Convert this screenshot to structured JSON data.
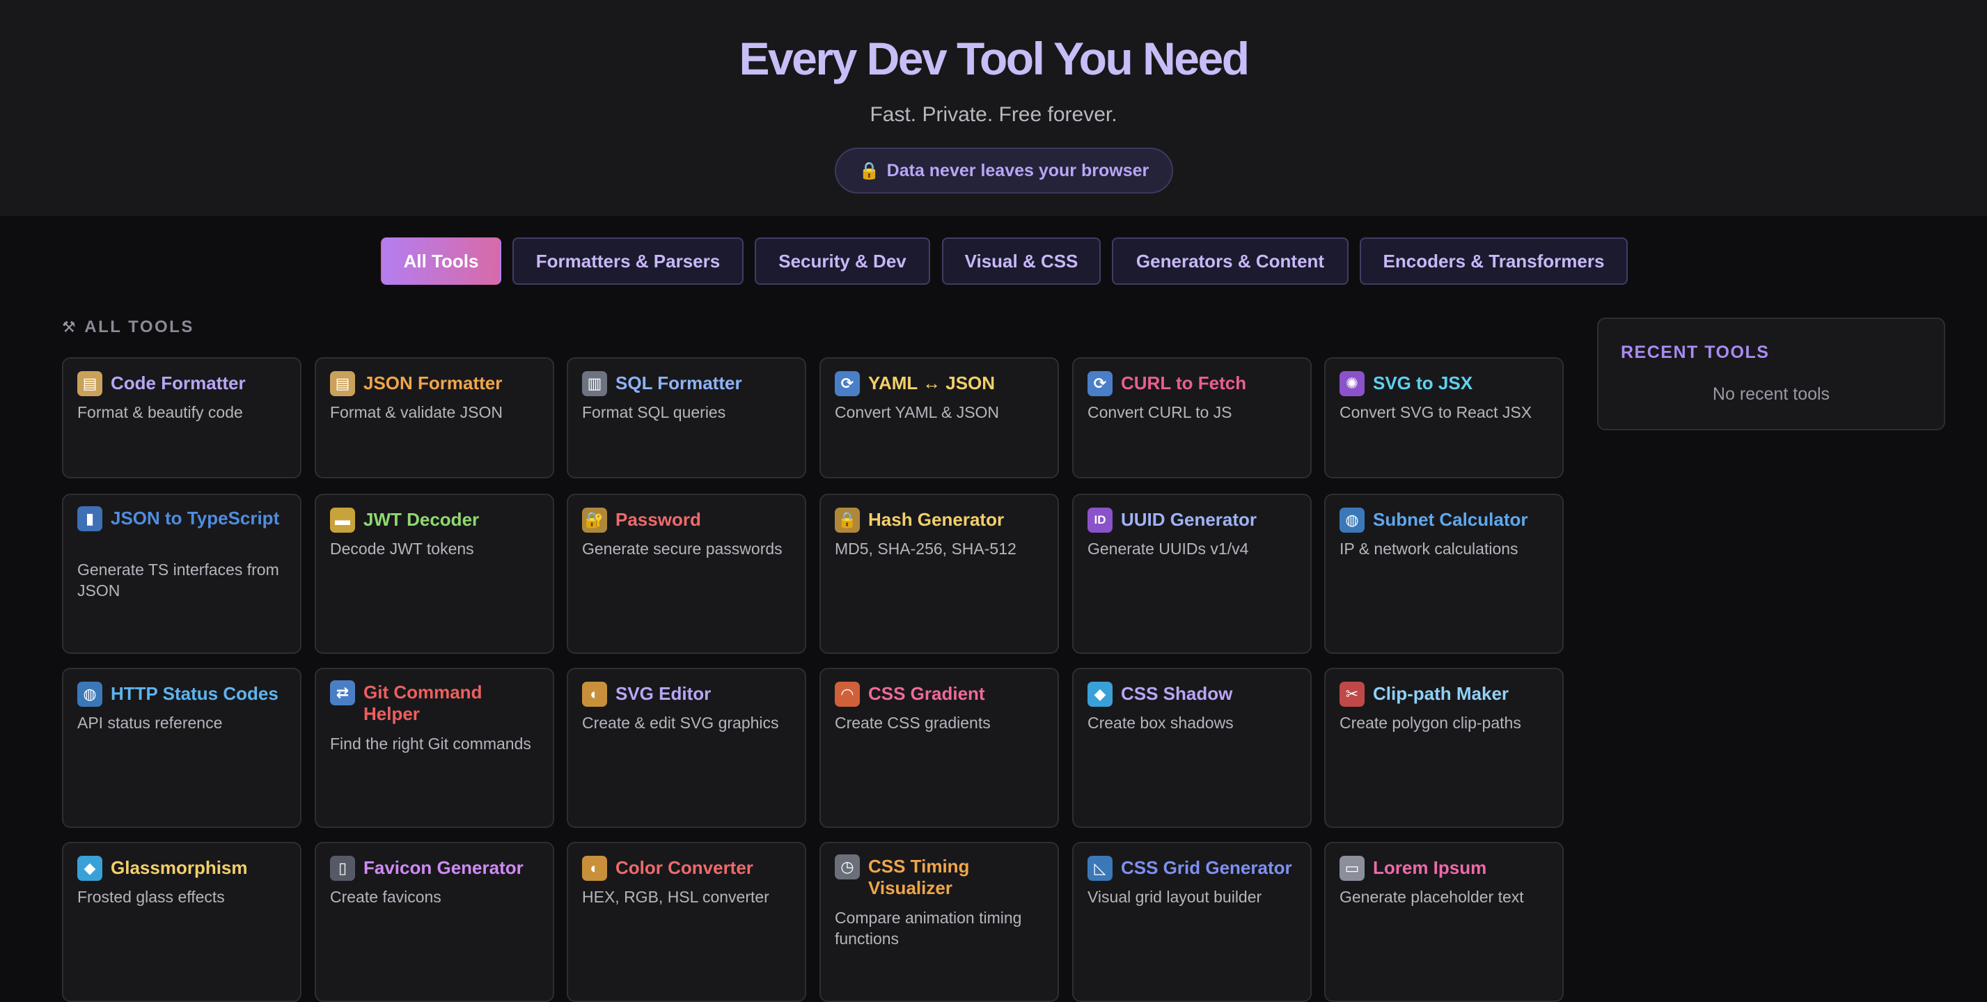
{
  "hero": {
    "title": "Every Dev Tool You Need",
    "subtitle": "Fast. Private. Free forever.",
    "badge": "Data never leaves your browser"
  },
  "tabs": [
    {
      "label": "All Tools",
      "active": true
    },
    {
      "label": "Formatters & Parsers",
      "active": false
    },
    {
      "label": "Security & Dev",
      "active": false
    },
    {
      "label": "Visual & CSS",
      "active": false
    },
    {
      "label": "Generators & Content",
      "active": false
    },
    {
      "label": "Encoders & Transformers",
      "active": false
    }
  ],
  "section_label": "ALL TOOLS",
  "tools": [
    {
      "title": "Code Formatter",
      "desc": "Format & beautify code",
      "icon": "clipboard-icon",
      "glyph": "▤",
      "icon_bg": "#c9a15a",
      "color": "#b9a6f5"
    },
    {
      "title": "JSON Formatter",
      "desc": "Format & validate JSON",
      "icon": "clipboard-icon",
      "glyph": "▤",
      "icon_bg": "#c9a15a",
      "color": "#f0a64a"
    },
    {
      "title": "SQL Formatter",
      "desc": "Format SQL queries",
      "icon": "cabinet-icon",
      "glyph": "▥",
      "icon_bg": "#6d7380",
      "color": "#8fb2f5"
    },
    {
      "title": "YAML ↔ JSON",
      "desc": "Convert YAML & JSON",
      "icon": "convert-icon",
      "glyph": "⟳",
      "icon_bg": "#4a7fc8",
      "color": "#f3cf6a"
    },
    {
      "title": "CURL to Fetch",
      "desc": "Convert CURL to JS",
      "icon": "convert-icon",
      "glyph": "⟳",
      "icon_bg": "#4a7fc8",
      "color": "#ea5f8f"
    },
    {
      "title": "SVG to JSX",
      "desc": "Convert SVG to React JSX",
      "icon": "atom-icon",
      "glyph": "✺",
      "icon_bg": "#8a53c9",
      "color": "#5fd2ee"
    },
    {
      "title": "JSON to TypeScript",
      "desc": "Generate TS interfaces from JSON",
      "icon": "book-icon",
      "glyph": "▮",
      "icon_bg": "#3f6fb5",
      "color": "#4f8de0"
    },
    {
      "title": "JWT Decoder",
      "desc": "Decode JWT tokens",
      "icon": "ticket-icon",
      "glyph": "▬",
      "icon_bg": "#c8a23a",
      "color": "#8fd96f"
    },
    {
      "title": "Password",
      "desc": "Generate secure passwords",
      "icon": "lock-key-icon",
      "glyph": "🔐",
      "icon_bg": "#b0883a",
      "color": "#ee6a6a"
    },
    {
      "title": "Hash Generator",
      "desc": "MD5, SHA-256, SHA-512",
      "icon": "lock-icon",
      "glyph": "🔒",
      "icon_bg": "#b0883a",
      "color": "#f3cf6a"
    },
    {
      "title": "UUID Generator",
      "desc": "Generate UUIDs v1/v4",
      "icon": "id-icon",
      "glyph": "ID",
      "icon_bg": "#8a53c9",
      "color": "#9fb3f5"
    },
    {
      "title": "Subnet Calculator",
      "desc": "IP & network calculations",
      "icon": "globe-icon",
      "glyph": "◍",
      "icon_bg": "#3b78b8",
      "color": "#5fa8ee"
    },
    {
      "title": "HTTP Status Codes",
      "desc": "API status reference",
      "icon": "globe-icon",
      "glyph": "◍",
      "icon_bg": "#3b78b8",
      "color": "#5fb4ee"
    },
    {
      "title": "Git Command Helper",
      "desc": "Find the right Git commands",
      "icon": "shuffle-icon",
      "glyph": "⇄",
      "icon_bg": "#4a7fc8",
      "color": "#ee5f5f"
    },
    {
      "title": "SVG Editor",
      "desc": "Create & edit SVG graphics",
      "icon": "palette-icon",
      "glyph": "◐",
      "icon_bg": "#c8903a",
      "color": "#b9a6f5"
    },
    {
      "title": "CSS Gradient",
      "desc": "Create CSS gradients",
      "icon": "rainbow-icon",
      "glyph": "◠",
      "icon_bg": "#d0603a",
      "color": "#ee6a9a"
    },
    {
      "title": "CSS Shadow",
      "desc": "Create box shadows",
      "icon": "gem-icon",
      "glyph": "◆",
      "icon_bg": "#3aa0d8",
      "color": "#b9a6f5"
    },
    {
      "title": "Clip-path Maker",
      "desc": "Create polygon clip-paths",
      "icon": "scissors-icon",
      "glyph": "✂",
      "icon_bg": "#c04848",
      "color": "#8fd1f5"
    },
    {
      "title": "Glassmorphism",
      "desc": "Frosted glass effects",
      "icon": "gem-icon",
      "glyph": "◆",
      "icon_bg": "#3aa0d8",
      "color": "#f3cf6a"
    },
    {
      "title": "Favicon Generator",
      "desc": "Create favicons",
      "icon": "phone-icon",
      "glyph": "▯",
      "icon_bg": "#555a66",
      "color": "#d08af5"
    },
    {
      "title": "Color Converter",
      "desc": "HEX, RGB, HSL converter",
      "icon": "palette-icon",
      "glyph": "◐",
      "icon_bg": "#c8903a",
      "color": "#ee6a6a"
    },
    {
      "title": "CSS Timing Visualizer",
      "desc": "Compare animation timing functions",
      "icon": "stopwatch-icon",
      "glyph": "◷",
      "icon_bg": "#6a6f7a",
      "color": "#f0a64a"
    },
    {
      "title": "CSS Grid Generator",
      "desc": "Visual grid layout builder",
      "icon": "ruler-icon",
      "glyph": "◺",
      "icon_bg": "#3b78b8",
      "color": "#7f90f0"
    },
    {
      "title": "Lorem Ipsum",
      "desc": "Generate placeholder text",
      "icon": "page-icon",
      "glyph": "▭",
      "icon_bg": "#8a8f9a",
      "color": "#ee6aa8"
    }
  ],
  "recent": {
    "title": "RECENT TOOLS",
    "empty": "No recent tools"
  }
}
